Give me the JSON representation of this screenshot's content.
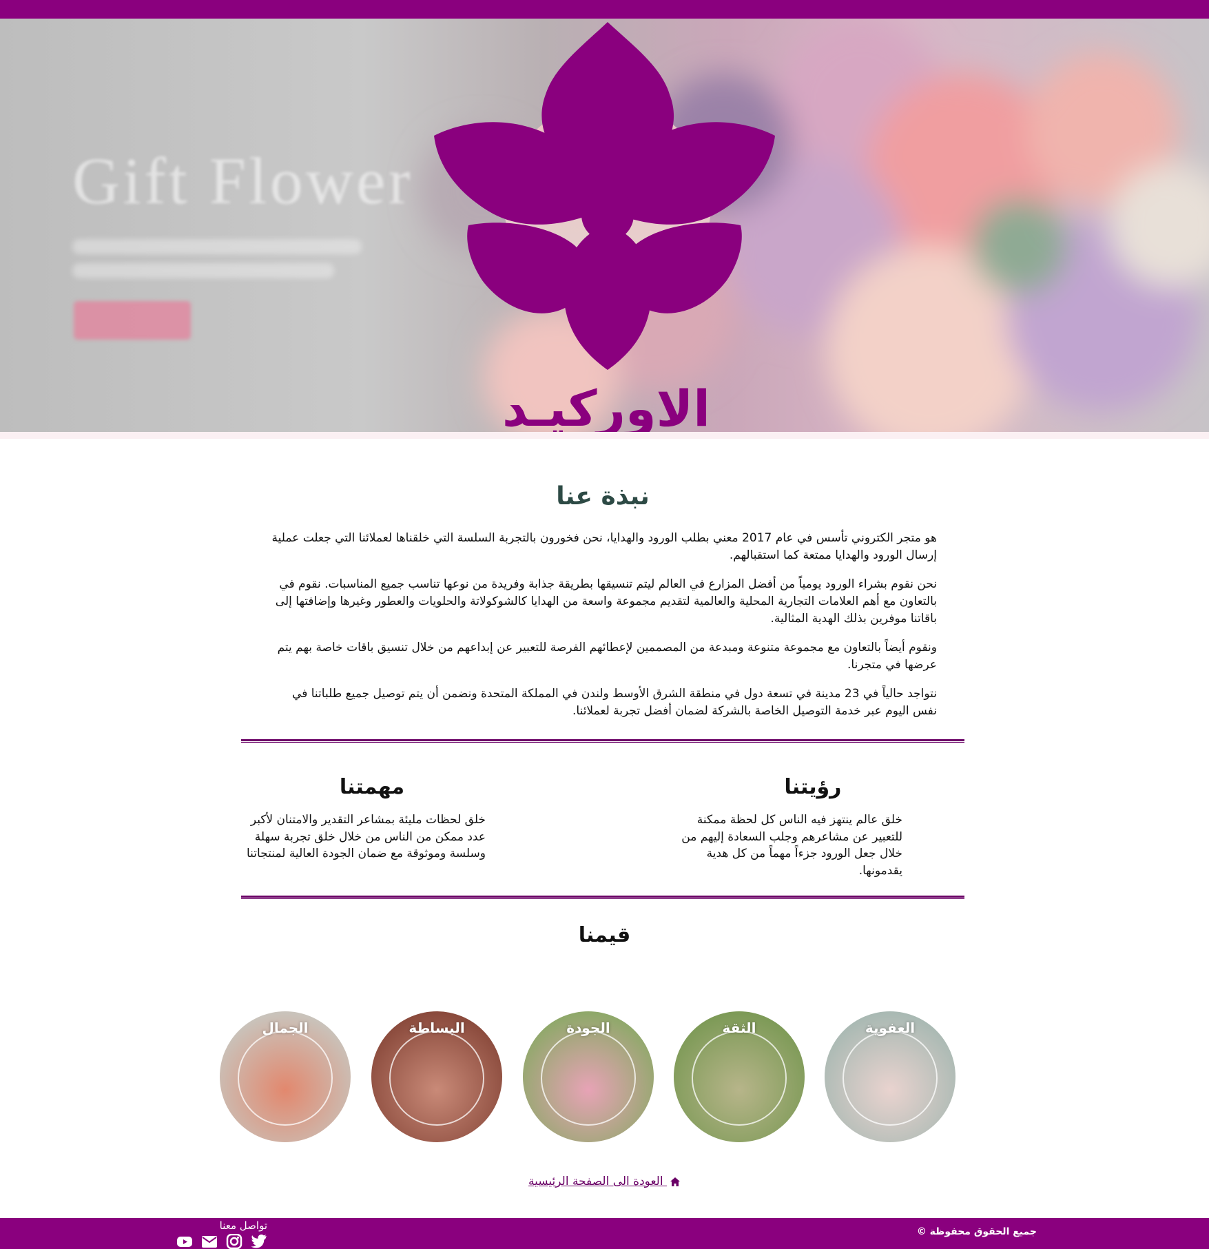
{
  "hero": {
    "banner_text": "Gift Flower",
    "brand_name": "الاوركيـد"
  },
  "about": {
    "title": "نبذة عنا",
    "paragraphs": [
      "هو متجر الكتروني تأسس في عام 2017 معني بطلب الورود والهدايا، نحن فخورون بالتجربة السلسة التي خلقناها لعملائنا التي جعلت عملية إرسال الورود والهدايا ممتعة كما استقبالهم.",
      "نحن نقوم بشراء الورود يومياً من أفضل المزارع في العالم ليتم تنسيقها بطريقة جذابة وفريدة من نوعها تناسب جميع المناسبات. نقوم في بالتعاون مع أهم العلامات التجارية المحلية والعالمية لتقديم مجموعة واسعة من الهدايا كالشوكولاتة والحلويات والعطور وغيرها وإضافتها إلى باقاتنا موفرين بذلك الهدية المثالية.",
      "ونقوم أيضاً بالتعاون مع مجموعة متنوعة ومبدعة من المصممين لإعطائهم الفرصة للتعبير عن إبداعهم من خلال تنسيق باقات خاصة بهم يتم عرضها في متجرنا.",
      "نتواجد حالياً في 23 مدينة في تسعة دول في منطقة الشرق الأوسط ولندن في المملكة المتحدة ونضمن أن يتم توصيل جميع طلباتنا في نفس اليوم عبر خدمة التوصيل الخاصة بالشركة لضمان أفضل تجربة لعملائنا."
    ]
  },
  "vision": {
    "title": "رؤيتنا",
    "text": "خلق عالم ينتهز فيه الناس كل لحظة ممكنة للتعبير عن مشاعرهم وجلب السعادة إليهم من خلال جعل الورود جزءاً مهماً من كل هدية يقدمونها."
  },
  "mission": {
    "title": "مهمتنا",
    "text": "خلق لحظات مليئة بمشاعر التقدير والامتنان لأكبر عدد ممكن من الناس من خلال خلق تجربة سهلة وسلسة وموثوقة مع ضمان الجودة العالية لمنتجاتنا"
  },
  "values": {
    "title": "قيمنا",
    "items": [
      {
        "label": "العفوية",
        "color_a": "#e9d3cf",
        "color_b": "#a9b9b3"
      },
      {
        "label": "الثقة",
        "color_a": "#b7b58a",
        "color_b": "#7d9a57"
      },
      {
        "label": "الجودة",
        "color_a": "#e7a3b6",
        "color_b": "#8fa86a"
      },
      {
        "label": "البساطة",
        "color_a": "#c98a78",
        "color_b": "#8a4a3c"
      },
      {
        "label": "الجمال",
        "color_a": "#e2886e",
        "color_b": "#c9c3bb"
      }
    ]
  },
  "back_link": "العودة الى الصفحة الرئيسية",
  "footer": {
    "copyright": "جميع الحقوق محفوظة ©",
    "contact_title": "تواصل معنا",
    "social_icons": [
      "youtube-icon",
      "email-icon",
      "instagram-icon",
      "twitter-icon"
    ]
  },
  "colors": {
    "brand": "#8a007e",
    "heading": "#2d4a45",
    "link": "#6a0066"
  }
}
